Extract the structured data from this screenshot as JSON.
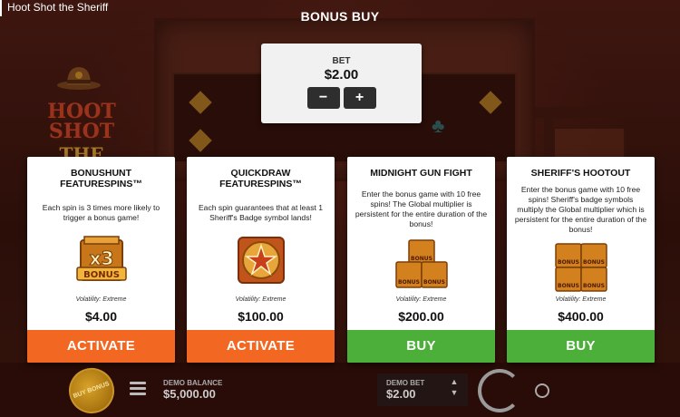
{
  "window": {
    "title": "Hoot Shot the Sheriff"
  },
  "modal": {
    "title": "BONUS BUY"
  },
  "logo": {
    "line1": "HOOT SHOT",
    "line2": "THE SHERIFF"
  },
  "bet": {
    "label": "BET",
    "value": "$2.00",
    "decrease_label": "−",
    "increase_label": "+"
  },
  "cards": [
    {
      "title": "BONUSHUNT\nFEATURESPINS™",
      "description": "Each spin is 3 times more likely to trigger a bonus game!",
      "icon": "x3-bonus-icon",
      "icon_text": [
        "x3",
        "BONUS"
      ],
      "volatility": "Volatility: Extreme",
      "price": "$4.00",
      "action": "ACTIVATE",
      "action_color": "#f26822"
    },
    {
      "title": "QUICKDRAW\nFEATURESPINS™",
      "description": "Each spin guarantees that at least 1 Sheriff's Badge symbol lands!",
      "icon": "sheriff-badge-icon",
      "volatility": "Volatility: Extreme",
      "price": "$100.00",
      "action": "ACTIVATE",
      "action_color": "#f26822"
    },
    {
      "title": "MIDNIGHT GUN FIGHT",
      "description": "Enter the bonus game with 10 free spins! The Global multiplier is persistent for the entire duration of the bonus!",
      "icon": "bonus-stack-icon",
      "icon_text": [
        "BONUS",
        "BONUS",
        "BONUS"
      ],
      "volatility": "Volatility: Extreme",
      "price": "$200.00",
      "action": "BUY",
      "action_color": "#4caf3a"
    },
    {
      "title": "SHERIFF'S HOOTOUT",
      "description": "Enter the bonus game with 10 free spins! Sheriff's badge symbols multiply the Global multiplier which is persistent for the entire duration of the bonus!",
      "icon": "bonus-stack-icon",
      "icon_text": [
        "BONUS",
        "BONUS",
        "BONUS",
        "BONUS"
      ],
      "volatility": "Volatility: Extreme",
      "price": "$400.00",
      "action": "BUY",
      "action_color": "#4caf3a"
    }
  ],
  "bottom_bar": {
    "buy_bonus_label": "BUY BONUS",
    "demo_balance_label": "DEMO BALANCE",
    "demo_balance_value": "$5,000.00",
    "demo_bet_label": "DEMO BET",
    "demo_bet_value": "$2.00"
  },
  "colors": {
    "orange": "#f26822",
    "green": "#4caf3a",
    "gold": "#e7b43c"
  }
}
